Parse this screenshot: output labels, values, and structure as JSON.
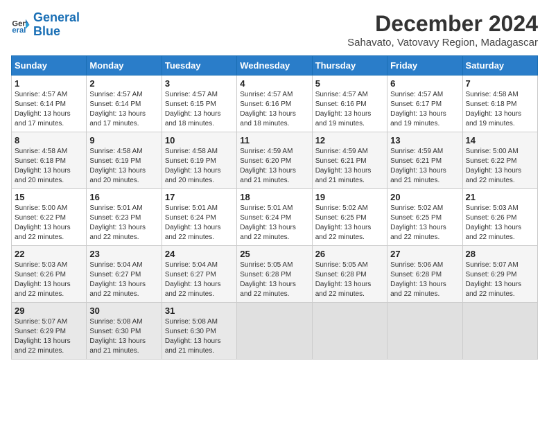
{
  "header": {
    "logo_line1": "General",
    "logo_line2": "Blue",
    "month": "December 2024",
    "location": "Sahavato, Vatovavy Region, Madagascar"
  },
  "days_of_week": [
    "Sunday",
    "Monday",
    "Tuesday",
    "Wednesday",
    "Thursday",
    "Friday",
    "Saturday"
  ],
  "weeks": [
    [
      {
        "day": 1,
        "info": "Sunrise: 4:57 AM\nSunset: 6:14 PM\nDaylight: 13 hours and 17 minutes."
      },
      {
        "day": 2,
        "info": "Sunrise: 4:57 AM\nSunset: 6:14 PM\nDaylight: 13 hours and 17 minutes."
      },
      {
        "day": 3,
        "info": "Sunrise: 4:57 AM\nSunset: 6:15 PM\nDaylight: 13 hours and 18 minutes."
      },
      {
        "day": 4,
        "info": "Sunrise: 4:57 AM\nSunset: 6:16 PM\nDaylight: 13 hours and 18 minutes."
      },
      {
        "day": 5,
        "info": "Sunrise: 4:57 AM\nSunset: 6:16 PM\nDaylight: 13 hours and 19 minutes."
      },
      {
        "day": 6,
        "info": "Sunrise: 4:57 AM\nSunset: 6:17 PM\nDaylight: 13 hours and 19 minutes."
      },
      {
        "day": 7,
        "info": "Sunrise: 4:58 AM\nSunset: 6:18 PM\nDaylight: 13 hours and 19 minutes."
      }
    ],
    [
      {
        "day": 8,
        "info": "Sunrise: 4:58 AM\nSunset: 6:18 PM\nDaylight: 13 hours and 20 minutes."
      },
      {
        "day": 9,
        "info": "Sunrise: 4:58 AM\nSunset: 6:19 PM\nDaylight: 13 hours and 20 minutes."
      },
      {
        "day": 10,
        "info": "Sunrise: 4:58 AM\nSunset: 6:19 PM\nDaylight: 13 hours and 20 minutes."
      },
      {
        "day": 11,
        "info": "Sunrise: 4:59 AM\nSunset: 6:20 PM\nDaylight: 13 hours and 21 minutes."
      },
      {
        "day": 12,
        "info": "Sunrise: 4:59 AM\nSunset: 6:21 PM\nDaylight: 13 hours and 21 minutes."
      },
      {
        "day": 13,
        "info": "Sunrise: 4:59 AM\nSunset: 6:21 PM\nDaylight: 13 hours and 21 minutes."
      },
      {
        "day": 14,
        "info": "Sunrise: 5:00 AM\nSunset: 6:22 PM\nDaylight: 13 hours and 22 minutes."
      }
    ],
    [
      {
        "day": 15,
        "info": "Sunrise: 5:00 AM\nSunset: 6:22 PM\nDaylight: 13 hours and 22 minutes."
      },
      {
        "day": 16,
        "info": "Sunrise: 5:01 AM\nSunset: 6:23 PM\nDaylight: 13 hours and 22 minutes."
      },
      {
        "day": 17,
        "info": "Sunrise: 5:01 AM\nSunset: 6:24 PM\nDaylight: 13 hours and 22 minutes."
      },
      {
        "day": 18,
        "info": "Sunrise: 5:01 AM\nSunset: 6:24 PM\nDaylight: 13 hours and 22 minutes."
      },
      {
        "day": 19,
        "info": "Sunrise: 5:02 AM\nSunset: 6:25 PM\nDaylight: 13 hours and 22 minutes."
      },
      {
        "day": 20,
        "info": "Sunrise: 5:02 AM\nSunset: 6:25 PM\nDaylight: 13 hours and 22 minutes."
      },
      {
        "day": 21,
        "info": "Sunrise: 5:03 AM\nSunset: 6:26 PM\nDaylight: 13 hours and 22 minutes."
      }
    ],
    [
      {
        "day": 22,
        "info": "Sunrise: 5:03 AM\nSunset: 6:26 PM\nDaylight: 13 hours and 22 minutes."
      },
      {
        "day": 23,
        "info": "Sunrise: 5:04 AM\nSunset: 6:27 PM\nDaylight: 13 hours and 22 minutes."
      },
      {
        "day": 24,
        "info": "Sunrise: 5:04 AM\nSunset: 6:27 PM\nDaylight: 13 hours and 22 minutes."
      },
      {
        "day": 25,
        "info": "Sunrise: 5:05 AM\nSunset: 6:28 PM\nDaylight: 13 hours and 22 minutes."
      },
      {
        "day": 26,
        "info": "Sunrise: 5:05 AM\nSunset: 6:28 PM\nDaylight: 13 hours and 22 minutes."
      },
      {
        "day": 27,
        "info": "Sunrise: 5:06 AM\nSunset: 6:28 PM\nDaylight: 13 hours and 22 minutes."
      },
      {
        "day": 28,
        "info": "Sunrise: 5:07 AM\nSunset: 6:29 PM\nDaylight: 13 hours and 22 minutes."
      }
    ],
    [
      {
        "day": 29,
        "info": "Sunrise: 5:07 AM\nSunset: 6:29 PM\nDaylight: 13 hours and 22 minutes."
      },
      {
        "day": 30,
        "info": "Sunrise: 5:08 AM\nSunset: 6:30 PM\nDaylight: 13 hours and 21 minutes."
      },
      {
        "day": 31,
        "info": "Sunrise: 5:08 AM\nSunset: 6:30 PM\nDaylight: 13 hours and 21 minutes."
      },
      null,
      null,
      null,
      null
    ]
  ]
}
